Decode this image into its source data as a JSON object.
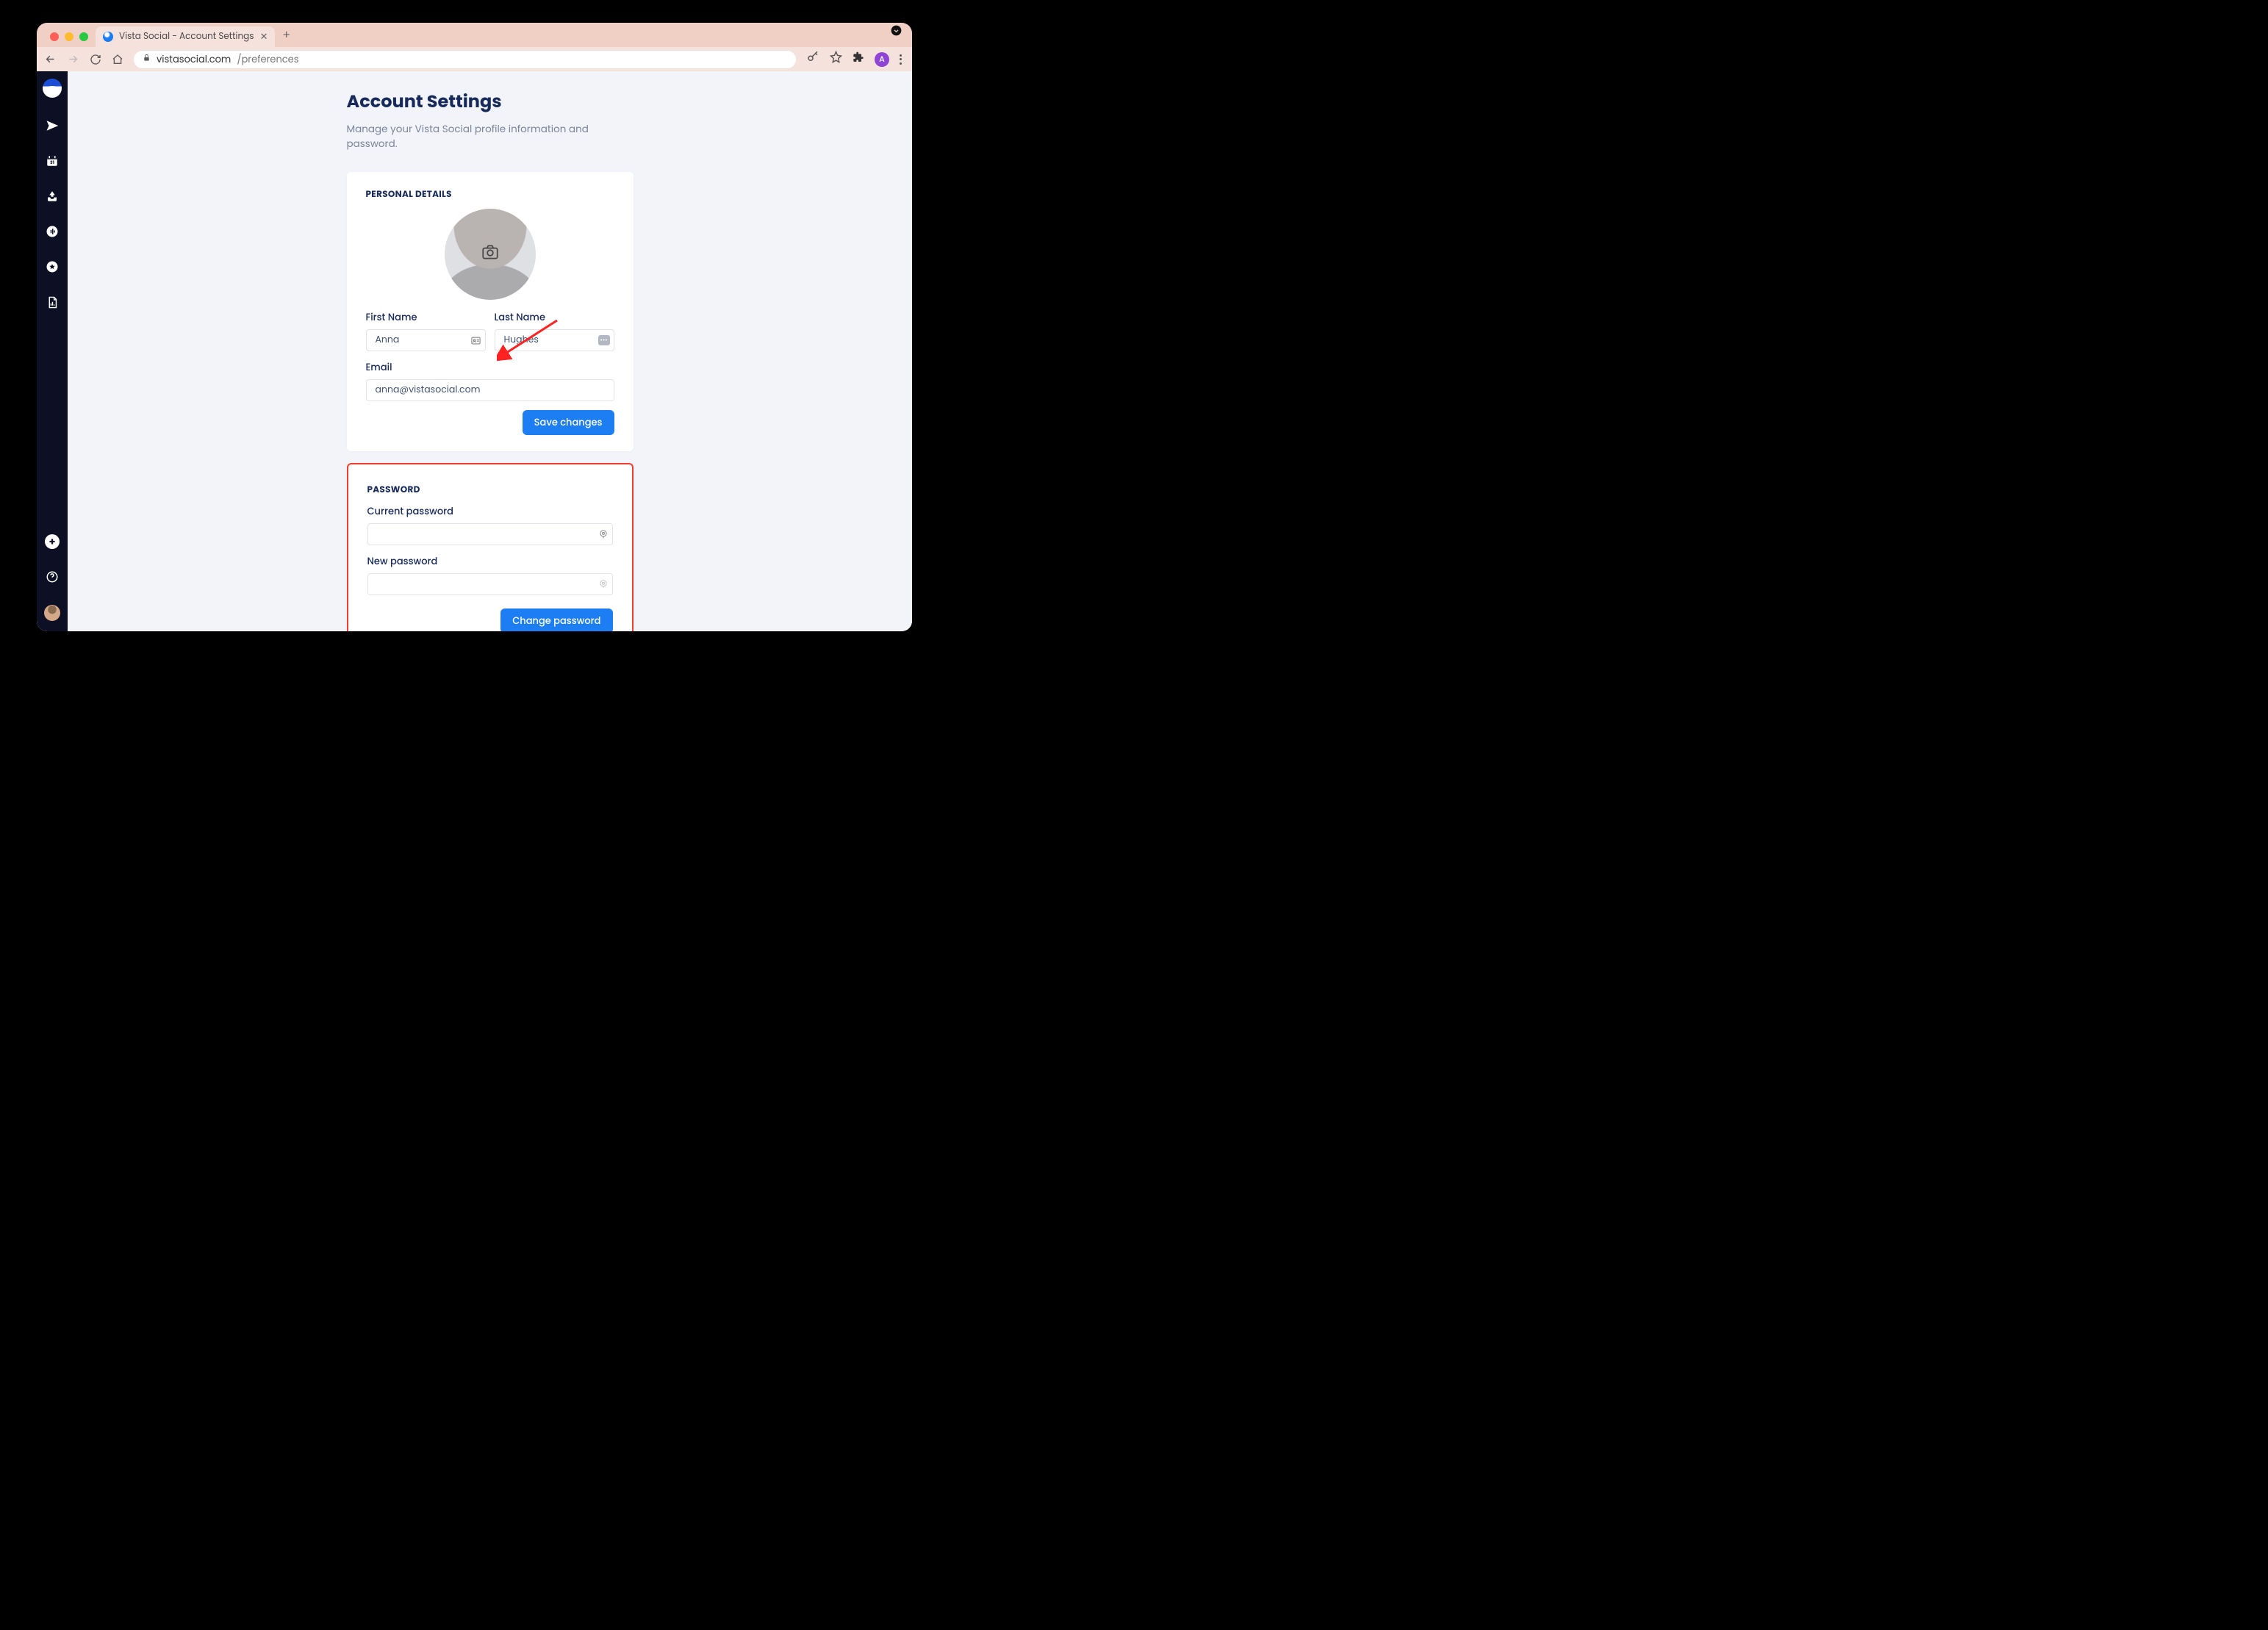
{
  "browser": {
    "tab_title": "Vista Social - Account Settings",
    "url_host": "vistasocial.com",
    "url_path": "/preferences",
    "avatar_initial": "A"
  },
  "page": {
    "title": "Account Settings",
    "subtitle": "Manage your Vista Social profile information and password."
  },
  "personal": {
    "section_title": "PERSONAL DETAILS",
    "first_name_label": "First Name",
    "first_name_value": "Anna",
    "last_name_label": "Last Name",
    "last_name_value": "Hughes",
    "email_label": "Email",
    "email_value": "anna@vistasocial.com",
    "save_button": "Save changes"
  },
  "password": {
    "section_title": "PASSWORD",
    "current_label": "Current password",
    "current_value": "",
    "new_label": "New password",
    "new_value": "",
    "change_button": "Change password"
  }
}
